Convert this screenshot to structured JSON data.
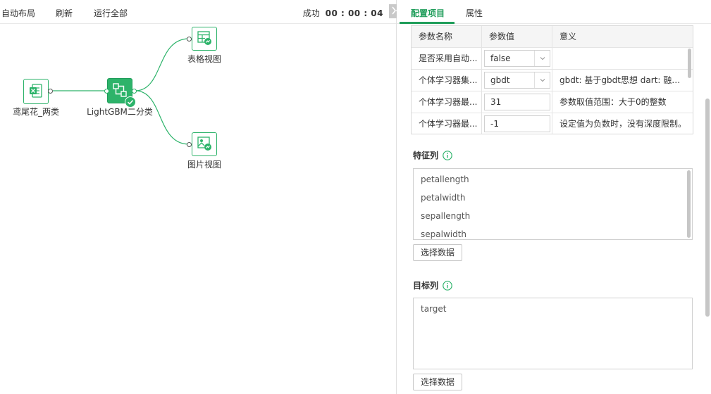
{
  "toolbar": {
    "auto_layout": "自动布局",
    "refresh": "刷新",
    "run_all": "运行全部",
    "status_label": "成功",
    "status_time": "00 : 00 : 04"
  },
  "nodes": {
    "source": {
      "label": "鸢尾花_两类",
      "icon": "excel-icon"
    },
    "model": {
      "label": "LightGBM二分类",
      "icon": "model-icon"
    },
    "table_view": {
      "label": "表格视图",
      "icon": "table-view-icon"
    },
    "image_view": {
      "label": "图片视图",
      "icon": "image-view-icon"
    }
  },
  "tabs": [
    {
      "label": "配置项目",
      "active": true
    },
    {
      "label": "属性",
      "active": false
    }
  ],
  "param_table": {
    "headers": [
      "参数名称",
      "参数值",
      "意义"
    ],
    "rows": [
      {
        "name": "是否采用自动...",
        "value": "false",
        "kind": "select",
        "meaning": ""
      },
      {
        "name": "个体学习器集...",
        "value": "gbdt",
        "kind": "select",
        "meaning": "gbdt: 基于gbdt思想 dart: 融合dro..."
      },
      {
        "name": "个体学习器最...",
        "value": "31",
        "kind": "input",
        "meaning": "参数取值范围：大于0的整数"
      },
      {
        "name": "个体学习器最...",
        "value": "-1",
        "kind": "input",
        "meaning": "设定值为负数时，没有深度限制。"
      }
    ]
  },
  "feature_section": {
    "title": "特征列",
    "items": [
      "petallength",
      "petalwidth",
      "sepallength",
      "sepalwidth"
    ],
    "button": "选择数据"
  },
  "target_section": {
    "title": "目标列",
    "items": [
      "target"
    ],
    "button": "选择数据"
  },
  "colors": {
    "accent": "#1f9d5a",
    "node_border": "#2db36a",
    "node_selected_fill": "#2db36a"
  }
}
